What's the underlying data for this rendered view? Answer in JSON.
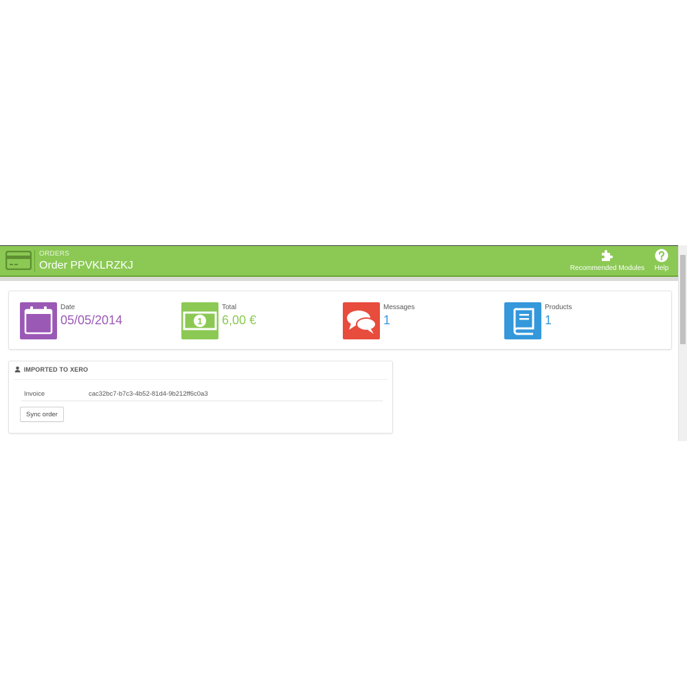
{
  "header": {
    "breadcrumb": "ORDERS",
    "title": "Order PPVKLRZKJ",
    "section_icon": "credit-card-icon",
    "color": "#8bc954",
    "toolbar": [
      {
        "label": "Recommended Modules",
        "icon": "puzzle-icon"
      },
      {
        "label": "Help",
        "icon": "help-icon"
      }
    ]
  },
  "kpis": [
    {
      "label": "Date",
      "value": "05/05/2014",
      "icon": "calendar-icon",
      "color": "#9b59b6"
    },
    {
      "label": "Total",
      "value": "6,00 €",
      "icon": "money-icon",
      "color": "#8bc954"
    },
    {
      "label": "Messages",
      "value": "1",
      "icon": "messages-icon",
      "color": "#e74c3c"
    },
    {
      "label": "Products",
      "value": "1",
      "icon": "book-icon",
      "color": "#3498db"
    }
  ],
  "xero": {
    "heading": "IMPORTED TO XERO",
    "heading_icon": "user-icon",
    "invoice_label": "Invoice",
    "invoice_value": "cac32bc7-b7c3-4b52-81d4-9b212ff6c0a3",
    "sync_button": "Sync order"
  }
}
